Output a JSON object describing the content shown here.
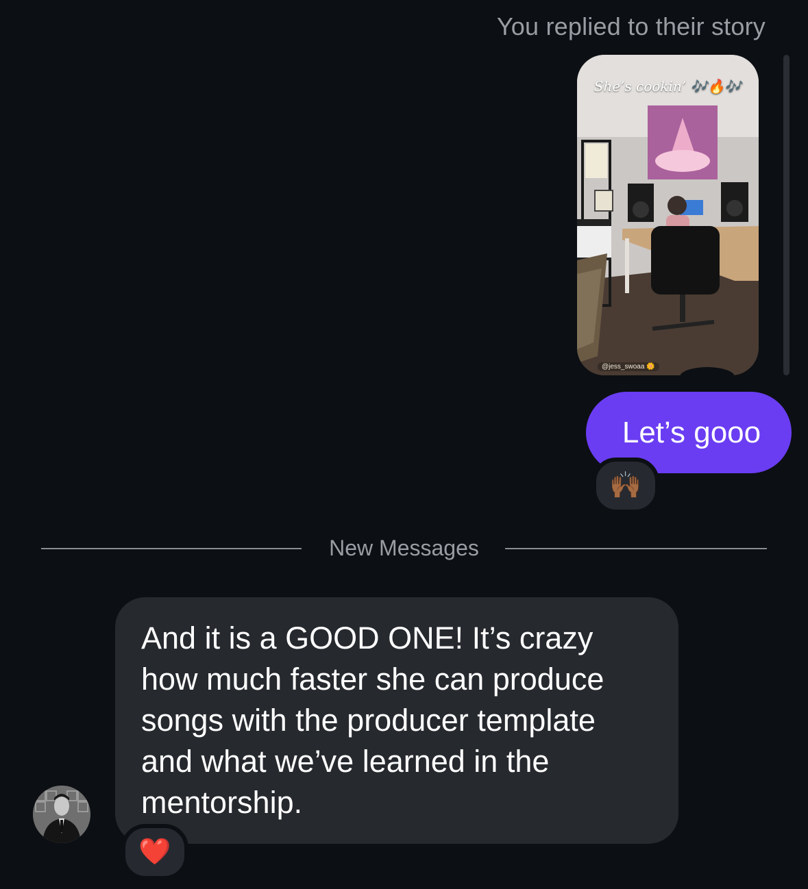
{
  "thread": {
    "story_reply_note": "You replied to their story",
    "story": {
      "caption": "She’s cookin’ 🎶🔥🎶",
      "handle": "@jess_swoaa 🌼"
    },
    "sent_message": {
      "text": "Let’s gooo",
      "reaction": "🙌🏾"
    },
    "divider_label": "New Messages",
    "received_message": {
      "text": "And it is a GOOD ONE! It’s crazy how much faster she can produce songs with the producer template and what we’ve learned in the mentorship.",
      "reaction": "❤️"
    }
  },
  "colors": {
    "background": "#0c0f13",
    "sent_bubble": "#6a3df2",
    "received_bubble": "#26292e",
    "muted_text": "#9a9da3"
  }
}
